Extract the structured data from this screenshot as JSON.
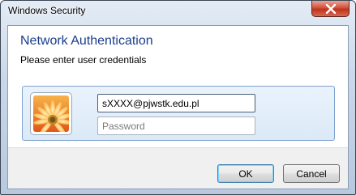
{
  "window": {
    "title": "Windows Security"
  },
  "dialog": {
    "heading": "Network Authentication",
    "subheading": "Please enter user credentials"
  },
  "credentials": {
    "username_value": "sXXXX@pjwstk.edu.pl",
    "password_placeholder": "Password",
    "avatar_icon": "flower-user-tile-icon"
  },
  "buttons": {
    "ok_label": "OK",
    "cancel_label": "Cancel"
  },
  "colors": {
    "heading": "#1a3e8c",
    "close_button": "#c0321a",
    "panel_border": "#7da2ce"
  }
}
